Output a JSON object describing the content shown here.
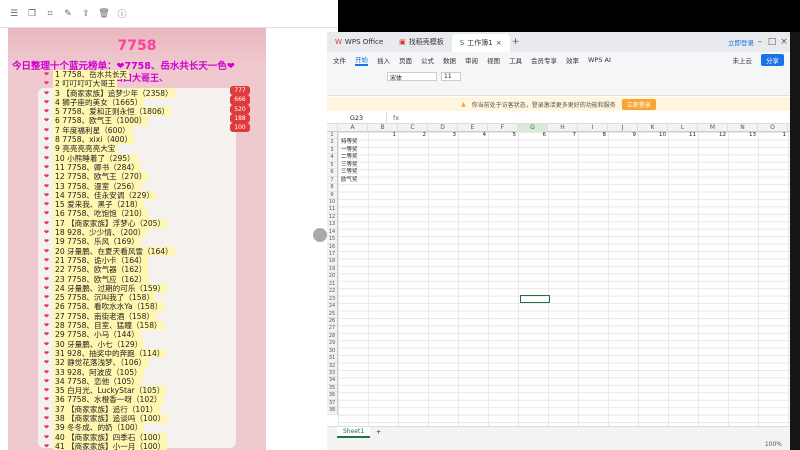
{
  "left_viewer": {
    "toolbar_icons": [
      "menu-icon",
      "copy-icon",
      "crop-icon",
      "edit-icon",
      "share-icon",
      "delete-icon",
      "info-icon"
    ],
    "photo": {
      "title": "7758",
      "heading_line1": "今日整理十个蓝元榜单：❤7758、岳水共长天一色❤",
      "heading_line2": "口口口口口口大哥王、",
      "rows": [
        "1  7758、岳水共长天",
        "2  叮叮叮叮大哥王",
        "3  【商家家族】追梦少年（2358）",
        "4  狮子座的美女（1665）",
        "5  7758、爱和正则永恒（1806）",
        "6  7758、欧气王（1000）",
        "7  年度福利星（600）",
        "8  7758、xixi（400）",
        "9  亮亮亮亮亮大宝",
        "10  小熊睡着了（295）",
        "11  7758、卿书（284）",
        "12  7758、欧气王（270）",
        "13  7758、漫室（256）",
        "14  7758、佳永安调（229）",
        "15  爱来我、黑子（218）",
        "16  7758、吃饱饱（210）",
        "17  【商家家族】浮梦心（205）",
        "18  928、少少情、（200）",
        "19  7758、乐风（169）",
        "20  牙量鹏、在夏天看风雪（164）",
        "21  7758、诡小卡（164）",
        "22  7758、欧气器（162）",
        "23  7758、欧气应（162）",
        "24  牙量鹏、过期的可乐（159）",
        "25  7758、沉叫我了（158）",
        "26  7758、看吹水水Ya（158）",
        "27  7758、南街老酒（158）",
        "28  7758、目室、猛瞳（158）",
        "29  7758、小马（144）",
        "30  牙量鹏、小七（129）",
        "31  928、抽奖中的奔跑（114）",
        "32  静觉花落浅梦、（106）",
        "33  928、阿波皮（105）",
        "34  7758、恋他（105）",
        "35  白月光、LuckyStar（105）",
        "36  7758、水橙香一呀（102）",
        "37  【商家家族】追行（101）",
        "38  【商家家族】追谈吗（100）",
        "39  冬冬成、的奶（100）",
        "40  【商家家族】四季石（100）",
        "41  【商家家族】小一月（100）"
      ],
      "badges": [
        "777",
        "666",
        "520",
        "188",
        "100"
      ]
    }
  },
  "wps": {
    "tabs": [
      {
        "label": "WPS Office",
        "icon": "wps-logo-icon"
      },
      {
        "label": "找稻壳模板",
        "icon": "template-icon"
      },
      {
        "label": "工作簿1",
        "icon": "sheet-icon"
      }
    ],
    "login": "立即登录",
    "menu": [
      "文件",
      "开始",
      "插入",
      "页面",
      "公式",
      "数据",
      "审阅",
      "视图",
      "工具",
      "会员专享",
      "效率",
      "WPS AI"
    ],
    "menu_active": "开始",
    "share": "分享",
    "cloud": "未上云",
    "font_name": "宋体",
    "font_size": "11",
    "notification": "你当前处于访客状态，登录激活更多更好的功能和服务",
    "notification_button": "立即登录",
    "name_box": "G23",
    "fx": "fx",
    "columns": [
      "A",
      "B",
      "C",
      "D",
      "E",
      "F",
      "G",
      "H",
      "I",
      "J",
      "K",
      "L",
      "M",
      "N",
      "O"
    ],
    "selected_column": "G",
    "row1_values": [
      "",
      "1",
      "2",
      "3",
      "4",
      "5",
      "6",
      "7",
      "8",
      "9",
      "10",
      "11",
      "12",
      "13",
      "1"
    ],
    "prizes": [
      "特等奖",
      "一等奖",
      "二等奖",
      "三等奖",
      "三等奖",
      "欧气奖"
    ],
    "rows": [
      "1",
      "2",
      "3",
      "4",
      "5",
      "6",
      "7",
      "8",
      "9",
      "10",
      "11",
      "12",
      "13",
      "14",
      "15",
      "16",
      "17",
      "18",
      "19",
      "20",
      "21",
      "22",
      "23",
      "24",
      "25",
      "26",
      "27",
      "28",
      "29",
      "30",
      "31",
      "32",
      "33",
      "34",
      "35",
      "36",
      "37",
      "38"
    ],
    "sheet_tab": "Sheet1",
    "zoom": "100%"
  }
}
